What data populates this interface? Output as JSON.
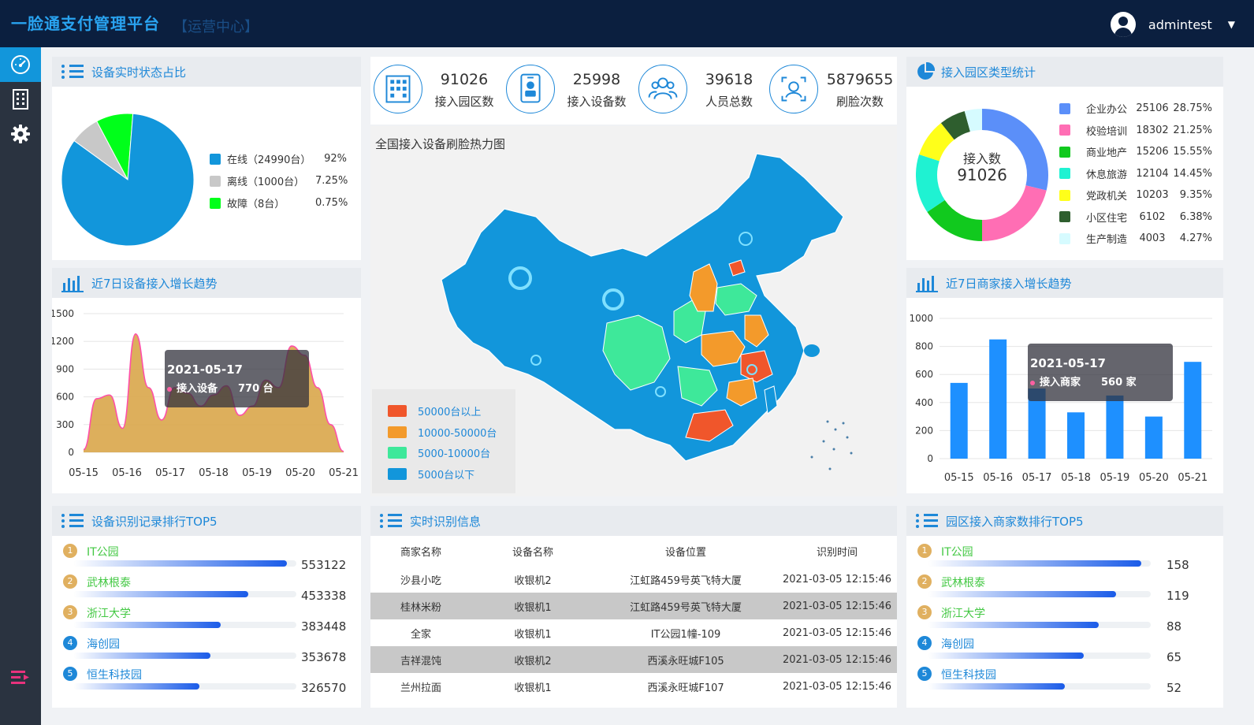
{
  "header": {
    "app_title": "一脸通支付管理平台",
    "subtitle": "【运营中心】",
    "username": "admintest",
    "avatar_icon": "user-avatar-icon",
    "dropdown_icon": "chevron-down-icon"
  },
  "sidebar": {
    "items": [
      {
        "icon": "dashboard-icon",
        "active": true
      },
      {
        "icon": "building-icon",
        "active": false
      },
      {
        "icon": "gear-icon",
        "active": false
      }
    ],
    "bottom_icon": "menu-collapse-icon"
  },
  "device_status": {
    "title": "设备实时状态占比",
    "items": [
      {
        "label": "在线（24990台）",
        "percent": "92%",
        "value": 92,
        "color": "#1296db"
      },
      {
        "label": "离线（1000台）",
        "percent": "7.25%",
        "value": 7.25,
        "color": "#c8c8c8"
      },
      {
        "label": "故障（8台）",
        "percent": "0.75%",
        "value": 0.75,
        "color": "#00ff1a"
      }
    ]
  },
  "stats": [
    {
      "value": "91026",
      "label": "接入园区数",
      "icon": "building-icon"
    },
    {
      "value": "25998",
      "label": "接入设备数",
      "icon": "device-badge-icon"
    },
    {
      "value": "39618",
      "label": "人员总数",
      "icon": "people-icon"
    },
    {
      "value": "5879655",
      "label": "刷脸次数",
      "icon": "face-scan-icon"
    }
  ],
  "map": {
    "title": "全国接入设备刷脸热力图",
    "legend": [
      {
        "label": "50000台以上",
        "color": "#f0562b"
      },
      {
        "label": "10000-50000台",
        "color": "#f39a2b"
      },
      {
        "label": "5000-10000台",
        "color": "#3ee89a"
      },
      {
        "label": "5000台以下",
        "color": "#1296db"
      }
    ]
  },
  "park_types": {
    "title": "接入园区类型统计",
    "center_label": "接入数",
    "center_value": "91026",
    "items": [
      {
        "name": "企业办公",
        "value": "25106",
        "percent": "28.75%",
        "pct": 28.75,
        "color": "#5b8ff9"
      },
      {
        "name": "校验培训",
        "value": "18302",
        "percent": "21.25%",
        "pct": 21.25,
        "color": "#ff6eb4"
      },
      {
        "name": "商业地产",
        "value": "15206",
        "percent": "15.55%",
        "pct": 15.55,
        "color": "#11c91e"
      },
      {
        "name": "休息旅游",
        "value": "12104",
        "percent": "14.45%",
        "pct": 14.45,
        "color": "#1ff2d2"
      },
      {
        "name": "党政机关",
        "value": "10203",
        "percent": "9.35%",
        "pct": 9.35,
        "color": "#ffff1a"
      },
      {
        "name": "小区住宅",
        "value": "6102",
        "percent": "6.38%",
        "pct": 6.38,
        "color": "#2e5e2e"
      },
      {
        "name": "生产制造",
        "value": "4003",
        "percent": "4.27%",
        "pct": 4.27,
        "color": "#d6fbff"
      }
    ]
  },
  "device_trend": {
    "title": "近7日设备接入增长趋势",
    "tooltip": {
      "date": "2021-05-17",
      "label": "接入设备",
      "value": "770 台"
    }
  },
  "merchant_trend": {
    "title": "近7日商家接入增长趋势",
    "tooltip": {
      "date": "2021-05-17",
      "label": "接入商家",
      "value": "560 家"
    }
  },
  "chart_data": [
    {
      "type": "area",
      "title": "近7日设备接入增长趋势",
      "categories": [
        "05-15",
        "05-16",
        "05-17",
        "05-18",
        "05-19",
        "05-20",
        "05-21"
      ],
      "x": [
        0,
        0.3,
        0.6,
        0.9,
        1.2,
        1.5,
        1.8,
        2.1,
        2.4,
        2.7,
        3.0,
        3.3,
        3.6,
        3.9,
        4.2,
        4.5,
        4.8,
        5.1,
        5.4,
        5.7,
        6.0
      ],
      "values": [
        30,
        580,
        620,
        260,
        1280,
        700,
        350,
        700,
        640,
        500,
        620,
        720,
        400,
        500,
        780,
        700,
        1150,
        1050,
        700,
        300,
        10
      ],
      "ylim": [
        0,
        1500
      ],
      "yticks": [
        0,
        300,
        600,
        900,
        1200,
        1500
      ],
      "grid": true
    },
    {
      "type": "bar",
      "title": "近7日商家接入增长趋势",
      "categories": [
        "05-15",
        "05-16",
        "05-17",
        "05-18",
        "05-19",
        "05-20",
        "05-21"
      ],
      "values": [
        540,
        850,
        500,
        330,
        450,
        300,
        690
      ],
      "ylim": [
        0,
        1000
      ],
      "yticks": [
        0,
        200,
        400,
        600,
        800,
        1000
      ],
      "grid": true
    }
  ],
  "device_ranking": {
    "title": "设备识别记录排行TOP5",
    "items": [
      {
        "rank": "1",
        "name": "IT公园",
        "value": "553122",
        "fill": 1.0,
        "color": "#e0b060",
        "text_color": "#43c843"
      },
      {
        "rank": "2",
        "name": "武林根泰",
        "value": "453338",
        "fill": 0.82,
        "color": "#e0b060",
        "text_color": "#43c843"
      },
      {
        "rank": "3",
        "name": "浙江大学",
        "value": "383448",
        "fill": 0.69,
        "color": "#e0b060",
        "text_color": "#43c843"
      },
      {
        "rank": "4",
        "name": "海创园",
        "value": "353678",
        "fill": 0.64,
        "color": "#1e88d8",
        "text_color": "#1e88d8"
      },
      {
        "rank": "5",
        "name": "恒生科技园",
        "value": "326570",
        "fill": 0.59,
        "color": "#1e88d8",
        "text_color": "#1e88d8"
      }
    ]
  },
  "park_ranking": {
    "title": "园区接入商家数排行TOP5",
    "items": [
      {
        "rank": "1",
        "name": "IT公园",
        "value": "158",
        "fill": 1.0,
        "color": "#e0b060",
        "text_color": "#43c843"
      },
      {
        "rank": "2",
        "name": "武林根泰",
        "value": "119",
        "fill": 0.88,
        "color": "#e0b060",
        "text_color": "#43c843"
      },
      {
        "rank": "3",
        "name": "浙江大学",
        "value": "88",
        "fill": 0.8,
        "color": "#e0b060",
        "text_color": "#43c843"
      },
      {
        "rank": "4",
        "name": "海创园",
        "value": "65",
        "fill": 0.73,
        "color": "#1e88d8",
        "text_color": "#1e88d8"
      },
      {
        "rank": "5",
        "name": "恒生科技园",
        "value": "52",
        "fill": 0.64,
        "color": "#1e88d8",
        "text_color": "#1e88d8"
      }
    ]
  },
  "realtime": {
    "title": "实时识别信息",
    "columns": [
      "商家名称",
      "设备名称",
      "设备位置",
      "识别时间"
    ],
    "rows": [
      [
        "沙县小吃",
        "收银机2",
        "江虹路459号英飞特大厦",
        "2021-03-05 12:15:46"
      ],
      [
        "桂林米粉",
        "收银机1",
        "江虹路459号英飞特大厦",
        "2021-03-05 12:15:46"
      ],
      [
        "全家",
        "收银机1",
        "IT公园1幢-109",
        "2021-03-05 12:15:46"
      ],
      [
        "吉祥混饨",
        "收银机2",
        "西溪永旺城F105",
        "2021-03-05 12:15:46"
      ],
      [
        "兰州拉面",
        "收银机1",
        "西溪永旺城F107",
        "2021-03-05 12:15:46"
      ]
    ]
  }
}
